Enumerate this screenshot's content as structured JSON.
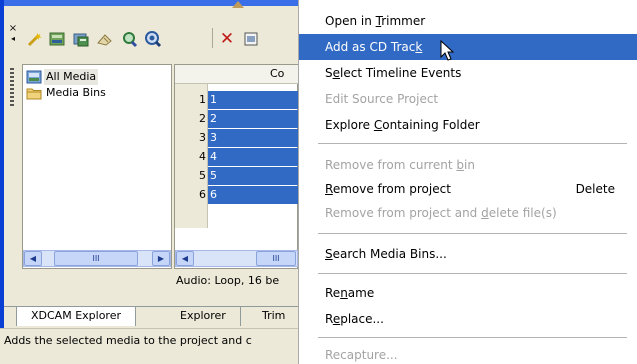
{
  "toolbar": {
    "collapse_glyph": "×",
    "icons": [
      "wand-icon",
      "import-media-icon",
      "media-properties-icon",
      "clear-icon",
      "zoom-icon",
      "search-icon",
      "delete-icon",
      "view-icon"
    ],
    "delete_glyph": "✕"
  },
  "tree": {
    "items": [
      {
        "label": "All Media",
        "icon": "all-media-icon"
      },
      {
        "label": "Media Bins",
        "icon": "folder-icon"
      }
    ],
    "scroll_thumb": "III"
  },
  "grid": {
    "header": "Co",
    "rows": [
      {
        "num": "1",
        "value": "1"
      },
      {
        "num": "2",
        "value": "2"
      },
      {
        "num": "3",
        "value": "3"
      },
      {
        "num": "4",
        "value": "4"
      },
      {
        "num": "5",
        "value": "5"
      },
      {
        "num": "6",
        "value": "6"
      }
    ],
    "scroll_thumb": "III"
  },
  "info": {
    "text": "Audio: Loop, 16 be"
  },
  "tabs": [
    {
      "label": "XDCAM Explorer"
    },
    {
      "label": "Explorer"
    },
    {
      "label": "Trim"
    }
  ],
  "status": {
    "text": "Adds the selected media to the project and c"
  },
  "menu": {
    "items": [
      {
        "pre": "Open in ",
        "u": "T",
        "post": "rimmer",
        "disabled": false,
        "selected": false,
        "shortcut": ""
      },
      {
        "pre": "Add as CD Trac",
        "u": "k",
        "post": "",
        "disabled": false,
        "selected": true,
        "shortcut": ""
      },
      {
        "pre": "S",
        "u": "e",
        "post": "lect Timeline Events",
        "disabled": false,
        "selected": false,
        "shortcut": ""
      },
      {
        "pre": "Edit Source Project",
        "u": "",
        "post": "",
        "disabled": true,
        "selected": false,
        "shortcut": ""
      },
      {
        "pre": "Explore ",
        "u": "C",
        "post": "ontaining Folder",
        "disabled": false,
        "selected": false,
        "shortcut": ""
      },
      {
        "pre": "Remove from current ",
        "u": "b",
        "post": "in",
        "disabled": true,
        "selected": false,
        "shortcut": ""
      },
      {
        "pre": "",
        "u": "R",
        "post": "emove from project",
        "disabled": false,
        "selected": false,
        "shortcut": "Delete"
      },
      {
        "pre": "Remove from project and ",
        "u": "d",
        "post": "elete file(s)",
        "disabled": true,
        "selected": false,
        "shortcut": ""
      },
      {
        "pre": "",
        "u": "S",
        "post": "earch Media Bins...",
        "disabled": false,
        "selected": false,
        "shortcut": ""
      },
      {
        "pre": "Re",
        "u": "n",
        "post": "ame",
        "disabled": false,
        "selected": false,
        "shortcut": ""
      },
      {
        "pre": "R",
        "u": "e",
        "post": "place...",
        "disabled": false,
        "selected": false,
        "shortcut": ""
      },
      {
        "pre": "Recapture...",
        "u": "",
        "post": "",
        "disabled": true,
        "selected": false,
        "shortcut": ""
      }
    ]
  },
  "colors": {
    "selection": "#316ac5",
    "window_frame": "#0a3fd6",
    "disabled_text": "#a3a3a3"
  }
}
